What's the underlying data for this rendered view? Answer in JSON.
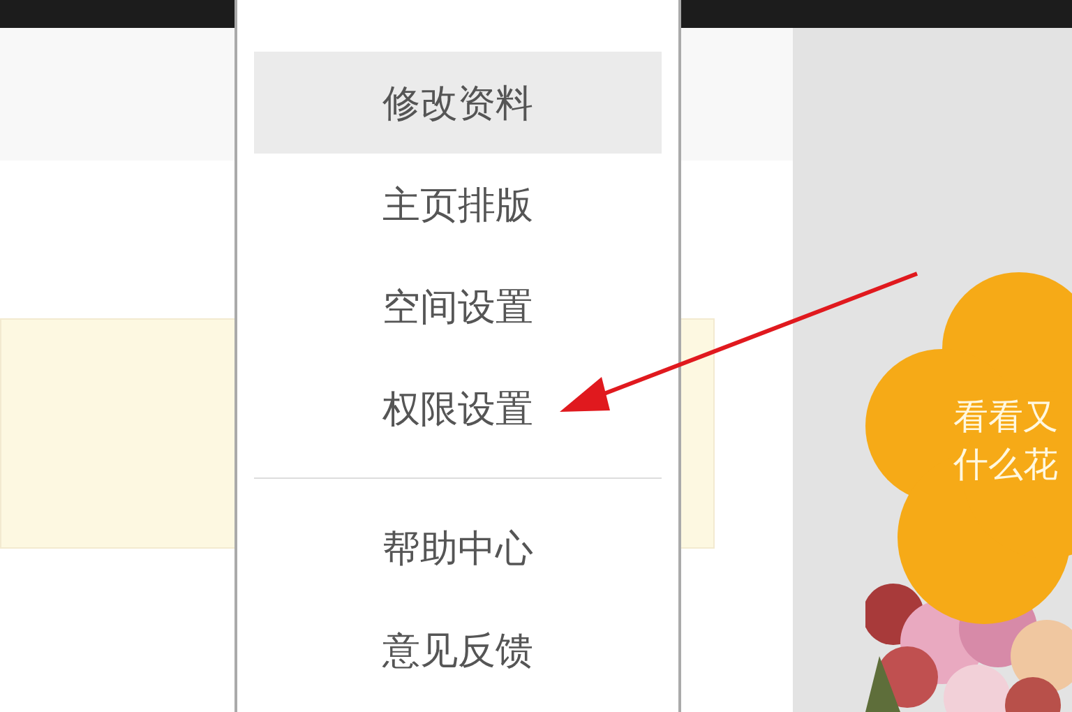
{
  "menu": {
    "groups": [
      {
        "items": [
          {
            "label": "修改资料",
            "selected": true
          },
          {
            "label": "主页排版",
            "selected": false
          },
          {
            "label": "空间设置",
            "selected": false
          },
          {
            "label": "权限设置",
            "selected": false
          }
        ]
      },
      {
        "items": [
          {
            "label": "帮助中心",
            "selected": false
          },
          {
            "label": "意见反馈",
            "selected": false
          }
        ]
      }
    ]
  },
  "promo": {
    "lines": [
      "看看又",
      "什么花"
    ]
  }
}
